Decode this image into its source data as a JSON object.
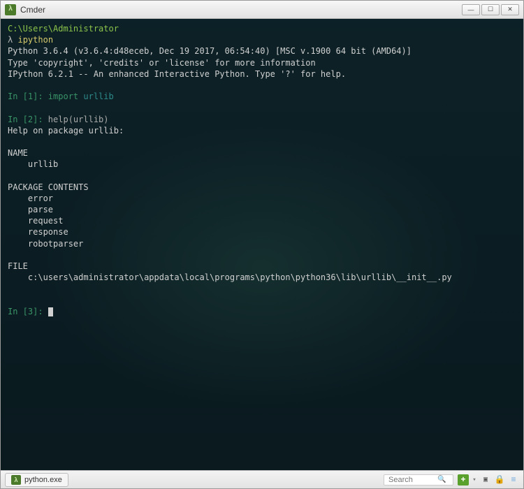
{
  "window": {
    "title": "Cmder"
  },
  "terminal": {
    "path": "C:\\Users\\Administrator",
    "lambda": "λ",
    "command": "ipython",
    "version_line": "Python 3.6.4 (v3.6.4:d48eceb, Dec 19 2017, 06:54:40) [MSC v.1900 64 bit (AMD64)]",
    "copyright_line": "Type 'copyright', 'credits' or 'license' for more information",
    "ipython_line": "IPython 6.2.1 -- An enhanced Interactive Python. Type '?' for help.",
    "in1_prompt": "In [1]: ",
    "in1_cmd_a": "import ",
    "in1_cmd_b": "urllib",
    "in2_prompt": "In [2]: ",
    "in2_cmd": "help(urllib)",
    "help_header": "Help on package urllib:",
    "name_label": "NAME",
    "name_value": "    urllib",
    "pkg_label": "PACKAGE CONTENTS",
    "pkg_items": [
      "    error",
      "    parse",
      "    request",
      "    response",
      "    robotparser"
    ],
    "file_label": "FILE",
    "file_value": "    c:\\users\\administrator\\appdata\\local\\programs\\python\\python36\\lib\\urllib\\__init__.py",
    "in3_prompt": "In [3]: "
  },
  "statusbar": {
    "tab_label": "python.exe",
    "search_placeholder": "Search"
  }
}
